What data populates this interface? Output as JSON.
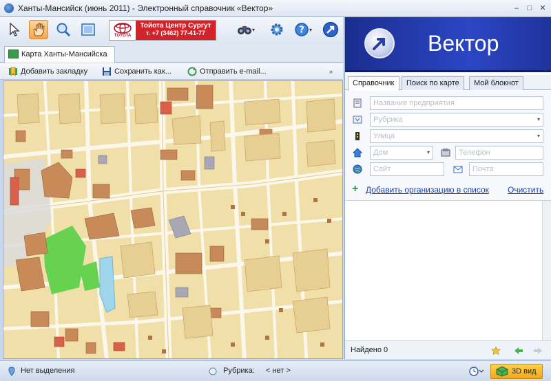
{
  "window": {
    "title": "Ханты-Мансийск (июнь 2011) - Электронный справочник «Вектор»",
    "minimize": "–",
    "maximize": "□",
    "close": "✕"
  },
  "toolbar": {
    "tools": [
      "pointer-icon",
      "hand-icon",
      "zoom-icon",
      "map-view-icon",
      "binoculars-icon",
      "gear-icon",
      "help-icon",
      "vector-logo-icon"
    ],
    "dropdown_marker": "▾",
    "ad": {
      "brand": "TOYOTA",
      "line1": "Тойота Центр Сургут",
      "line2": "т. +7 (3462) 77-41-77"
    }
  },
  "tab": {
    "label": "Карта Ханты-Мансийска"
  },
  "actions": {
    "bookmark": "Добавить закладку",
    "save": "Сохранить как...",
    "email": "Отправить e-mail..."
  },
  "right": {
    "brand": "Вектор",
    "collapse_marker": "»",
    "tabs": [
      "Справочник",
      "Поиск по карте",
      "Мой блокнот"
    ],
    "fields": {
      "org_name": "Название предприятия",
      "rubric": "Рубрика",
      "street": "Улица",
      "house": "Дом",
      "phone": "Телефон",
      "site": "Сайт",
      "email": "Почта"
    },
    "add_org": "Добавить организацию в список",
    "clear": "Очистить",
    "found_label": "Найдено",
    "found_count": "0"
  },
  "status": {
    "selection": "Нет выделения",
    "rubric_label": "Рубрика:",
    "rubric_value": "< нет >",
    "view3d": "3D вид"
  },
  "colors": {
    "map_bg": "#f0dfa8",
    "building": "#c98a5a",
    "park": "#66d24f",
    "water": "#9fd6ec",
    "banner": "#2c46c4"
  }
}
